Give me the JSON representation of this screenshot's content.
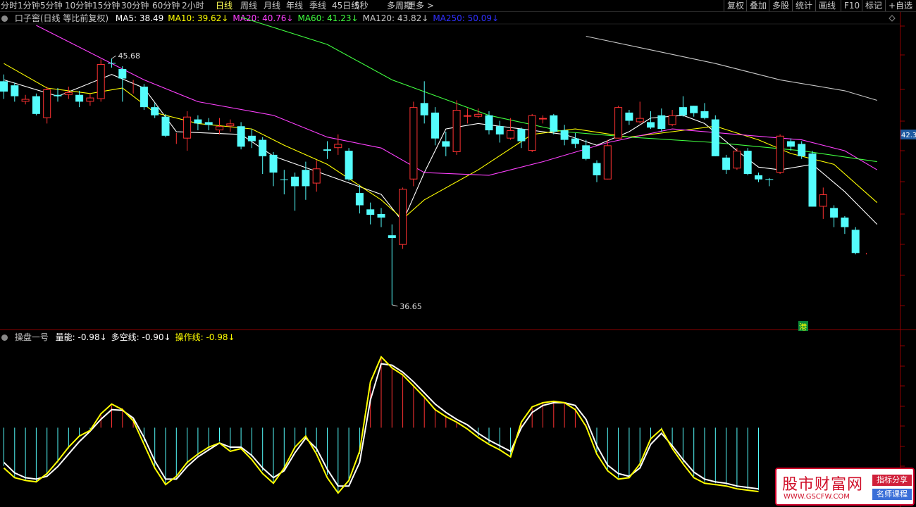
{
  "toolbar": {
    "tabs": [
      "分时",
      "1分钟",
      "5分钟",
      "10分钟",
      "15分钟",
      "30分钟",
      "60分钟",
      "2小时",
      "日线",
      "周线",
      "月线",
      "年线",
      "季线",
      "45日线",
      "5秒",
      "多周期",
      "更多 >"
    ],
    "active": "日线",
    "right_buttons": [
      "复权",
      "叠加",
      "多股",
      "统计",
      "画线",
      "F10",
      "标记",
      "+自选"
    ]
  },
  "main_legend": {
    "title": "口子窖(日线 等比前复权)",
    "items": [
      {
        "text": "MA5: 38.49",
        "color": "#ffffff"
      },
      {
        "text": "MA10: 39.62↓",
        "color": "#ffff00"
      },
      {
        "text": "MA20: 40.76↓",
        "color": "#ff40ff"
      },
      {
        "text": "MA60: 41.23↓",
        "color": "#40ff40"
      },
      {
        "text": "MA120: 43.82↓",
        "color": "#c8c8c8"
      },
      {
        "text": "MA250: 50.09↓",
        "color": "#3030ff"
      }
    ]
  },
  "sub_legend": {
    "title": "操盘一号",
    "items": [
      {
        "text": "量能: -0.98↓",
        "color": "#ffffff"
      },
      {
        "text": "多空线: -0.90↓",
        "color": "#ffffff"
      },
      {
        "text": "操作线: -0.98↓",
        "color": "#ffff00"
      }
    ]
  },
  "watermark": {
    "title": "股市财富网",
    "url": "WWW.GSCFW.COM",
    "tag1": "指标分享",
    "tag2": "名师课程"
  },
  "chart_data": [
    {
      "type": "candlestick",
      "ylim": [
        36.0,
        46.9
      ],
      "high_label": "45.68",
      "low_label": "36.65",
      "badge": "港",
      "price_tag": "42.3",
      "colors": {
        "up": "#ff3232",
        "down": "#54fcfc"
      },
      "candles": [
        [
          44.85,
          44.47,
          45.1,
          44.2
        ],
        [
          44.7,
          44.3,
          44.8,
          44.1
        ],
        [
          44.1,
          44.2,
          44.35,
          44.0
        ],
        [
          44.3,
          43.65,
          44.4,
          43.6
        ],
        [
          43.5,
          44.55,
          44.65,
          43.3
        ],
        [
          44.35,
          44.3,
          44.6,
          44.1
        ],
        [
          44.35,
          44.45,
          44.65,
          44.2
        ],
        [
          44.35,
          44.1,
          44.5,
          43.9
        ],
        [
          44.1,
          44.25,
          44.4,
          43.95
        ],
        [
          44.2,
          45.48,
          45.65,
          44.1
        ],
        [
          45.52,
          45.5,
          45.68,
          45.35
        ],
        [
          45.3,
          44.95,
          45.4,
          44.1
        ],
        [
          44.7,
          44.7,
          44.9,
          44.4
        ],
        [
          44.65,
          43.9,
          44.75,
          43.8
        ],
        [
          43.9,
          43.6,
          44.05,
          43.5
        ],
        [
          43.55,
          42.85,
          43.65,
          42.8
        ],
        [
          42.85,
          42.85,
          42.95,
          42.55
        ],
        [
          42.75,
          43.55,
          43.75,
          42.3
        ],
        [
          43.45,
          43.3,
          43.6,
          43.05
        ],
        [
          43.35,
          43.25,
          43.5,
          43.05
        ],
        [
          43.05,
          43.2,
          43.5,
          42.9
        ],
        [
          43.2,
          43.3,
          43.45,
          43.0
        ],
        [
          43.2,
          42.45,
          43.35,
          42.35
        ],
        [
          42.85,
          42.65,
          43.1,
          42.4
        ],
        [
          42.7,
          42.1,
          42.8,
          41.45
        ],
        [
          42.15,
          41.5,
          42.25,
          41.0
        ],
        [
          41.25,
          41.24,
          41.6,
          40.7
        ],
        [
          41.35,
          41.0,
          41.5,
          40.1
        ],
        [
          41.6,
          41.0,
          41.9,
          40.5
        ],
        [
          41.1,
          41.65,
          41.95,
          40.8
        ],
        [
          42.35,
          42.3,
          42.65,
          42.0
        ],
        [
          42.4,
          42.55,
          42.9,
          42.15
        ],
        [
          42.3,
          41.25,
          42.4,
          41.2
        ],
        [
          40.75,
          40.3,
          41.05,
          40.0
        ],
        [
          40.15,
          39.95,
          40.4,
          39.6
        ],
        [
          39.98,
          39.85,
          40.2,
          39.5
        ],
        [
          39.2,
          39.1,
          39.6,
          36.65
        ],
        [
          38.85,
          40.9,
          40.95,
          38.7
        ],
        [
          41.25,
          43.9,
          44.1,
          41.0
        ],
        [
          44.05,
          43.6,
          44.85,
          43.3
        ],
        [
          43.7,
          42.75,
          43.9,
          42.5
        ],
        [
          42.65,
          42.45,
          43.0,
          42.1
        ],
        [
          42.25,
          43.8,
          44.15,
          42.15
        ],
        [
          43.55,
          43.6,
          43.85,
          43.3
        ],
        [
          43.55,
          43.65,
          43.85,
          43.5
        ],
        [
          43.6,
          43.05,
          43.75,
          42.9
        ],
        [
          43.2,
          42.9,
          43.4,
          42.6
        ],
        [
          42.75,
          43.05,
          43.5,
          42.7
        ],
        [
          43.1,
          42.65,
          43.15,
          42.4
        ],
        [
          42.3,
          43.6,
          43.65,
          42.25
        ],
        [
          43.45,
          43.5,
          43.6,
          43.3
        ],
        [
          43.6,
          43.0,
          43.65,
          42.9
        ],
        [
          43.05,
          42.7,
          43.25,
          42.5
        ],
        [
          42.75,
          42.55,
          42.95,
          42.4
        ],
        [
          42.5,
          42.0,
          42.7,
          41.95
        ],
        [
          41.85,
          41.4,
          41.95,
          41.15
        ],
        [
          41.25,
          42.5,
          42.7,
          41.25
        ],
        [
          42.75,
          43.9,
          43.95,
          42.75
        ],
        [
          43.7,
          43.4,
          43.8,
          43.25
        ],
        [
          43.35,
          43.5,
          44.1,
          43.3
        ],
        [
          43.35,
          43.15,
          43.75,
          43.1
        ],
        [
          43.6,
          43.1,
          43.85,
          43.0
        ],
        [
          43.25,
          43.6,
          43.8,
          43.2
        ],
        [
          43.9,
          43.6,
          44.3,
          43.55
        ],
        [
          43.95,
          43.68,
          43.95,
          43.55
        ],
        [
          43.75,
          43.5,
          44.05,
          43.45
        ],
        [
          43.45,
          42.1,
          43.6,
          42.1
        ],
        [
          42.05,
          41.6,
          42.15,
          41.45
        ],
        [
          41.65,
          42.3,
          42.4,
          41.6
        ],
        [
          42.3,
          41.45,
          42.4,
          41.4
        ],
        [
          41.4,
          41.25,
          41.5,
          41.15
        ],
        [
          41.26,
          41.24,
          41.3,
          41.0
        ],
        [
          41.5,
          42.85,
          42.9,
          41.45
        ],
        [
          42.65,
          42.45,
          42.75,
          42.3
        ],
        [
          42.55,
          42.1,
          42.65,
          42.0
        ],
        [
          42.2,
          40.25,
          42.3,
          40.25
        ],
        [
          40.25,
          40.7,
          40.95,
          39.8
        ],
        [
          40.2,
          39.85,
          40.3,
          39.5
        ],
        [
          39.85,
          39.5,
          39.9,
          39.25
        ],
        [
          39.4,
          38.55,
          39.5,
          38.5
        ],
        [
          38.5,
          38.5,
          38.55,
          38.5
        ]
      ],
      "ma": [
        {
          "name": "MA5",
          "color": "#ffffff",
          "points": [
            [
              0,
              44.9
            ],
            [
              5,
              44.3
            ],
            [
              10,
              45.1
            ],
            [
              13,
              44.6
            ],
            [
              16,
              43.0
            ],
            [
              22,
              42.9
            ],
            [
              25,
              42.1
            ],
            [
              30,
              41.4
            ],
            [
              35,
              40.7
            ],
            [
              37,
              39.7
            ],
            [
              39,
              41.5
            ],
            [
              41,
              43.1
            ],
            [
              44,
              43.3
            ],
            [
              48,
              43.1
            ],
            [
              52,
              42.9
            ],
            [
              55,
              42.5
            ],
            [
              58,
              43.0
            ],
            [
              60,
              43.5
            ],
            [
              63,
              43.6
            ],
            [
              65,
              43.3
            ],
            [
              68,
              42.3
            ],
            [
              70,
              41.7
            ],
            [
              72,
              41.6
            ],
            [
              75,
              41.8
            ],
            [
              78,
              40.8
            ],
            [
              81,
              39.6
            ]
          ]
        },
        {
          "name": "MA10",
          "color": "#ffff00",
          "points": [
            [
              0,
              45.5
            ],
            [
              4,
              44.6
            ],
            [
              8,
              44.4
            ],
            [
              11,
              44.6
            ],
            [
              14,
              43.7
            ],
            [
              18,
              43.3
            ],
            [
              23,
              43.1
            ],
            [
              26,
              42.5
            ],
            [
              30,
              41.8
            ],
            [
              35,
              40.5
            ],
            [
              37,
              39.8
            ],
            [
              39,
              40.5
            ],
            [
              44,
              41.6
            ],
            [
              49,
              42.9
            ],
            [
              53,
              43.1
            ],
            [
              58,
              42.8
            ],
            [
              62,
              43.0
            ],
            [
              66,
              43.2
            ],
            [
              70,
              42.7
            ],
            [
              73,
              42.2
            ],
            [
              77,
              41.8
            ],
            [
              81,
              40.4
            ]
          ]
        },
        {
          "name": "MA20",
          "color": "#ff40ff",
          "points": [
            [
              3,
              46.9
            ],
            [
              9,
              45.7
            ],
            [
              13,
              44.9
            ],
            [
              18,
              44.1
            ],
            [
              25,
              43.6
            ],
            [
              30,
              42.8
            ],
            [
              35,
              42.4
            ],
            [
              39,
              41.5
            ],
            [
              45,
              41.4
            ],
            [
              50,
              41.9
            ],
            [
              56,
              42.6
            ],
            [
              62,
              43.1
            ],
            [
              68,
              42.9
            ],
            [
              74,
              42.7
            ],
            [
              78,
              42.3
            ],
            [
              81,
              41.6
            ]
          ]
        },
        {
          "name": "MA60",
          "color": "#40ff40",
          "points": [
            [
              22,
              47.2
            ],
            [
              30,
              46.2
            ],
            [
              36,
              44.9
            ],
            [
              45,
              43.6
            ],
            [
              52,
              43.0
            ],
            [
              58,
              42.8
            ],
            [
              66,
              42.6
            ],
            [
              74,
              42.3
            ],
            [
              81,
              41.9
            ]
          ]
        },
        {
          "name": "MA120",
          "color": "#c8c8c8",
          "points": [
            [
              54,
              46.5
            ],
            [
              60,
              46.0
            ],
            [
              66,
              45.5
            ],
            [
              72,
              44.9
            ],
            [
              78,
              44.5
            ],
            [
              81,
              44.15
            ]
          ]
        }
      ]
    },
    {
      "type": "line",
      "ylim": [
        -1.0,
        1.2
      ],
      "zero": 0.0,
      "bars": [
        -0.55,
        -0.72,
        -0.75,
        -0.78,
        -0.68,
        -0.5,
        -0.3,
        -0.12,
        -0.06,
        0.18,
        0.32,
        0.28,
        0.12,
        -0.2,
        -0.55,
        -0.8,
        -0.72,
        -0.52,
        -0.4,
        -0.3,
        -0.2,
        -0.32,
        -0.28,
        -0.42,
        -0.62,
        -0.78,
        -0.6,
        -0.3,
        -0.12,
        -0.35,
        -0.68,
        -0.92,
        -0.78,
        -0.38,
        0.6,
        1.0,
        0.88,
        0.78,
        0.62,
        0.45,
        0.28,
        0.18,
        0.08,
        0.0,
        -0.12,
        -0.22,
        -0.3,
        -0.4,
        0.06,
        0.28,
        0.35,
        0.37,
        0.36,
        0.28,
        0.05,
        -0.35,
        -0.6,
        -0.72,
        -0.72,
        -0.55,
        -0.18,
        -0.02,
        -0.28,
        -0.5,
        -0.7,
        -0.78,
        -0.8,
        -0.82,
        -0.86,
        -0.88,
        -0.9
      ],
      "series": [
        {
          "name": "多空线",
          "color": "#ffffff",
          "values": [
            -0.5,
            -0.65,
            -0.72,
            -0.74,
            -0.7,
            -0.56,
            -0.38,
            -0.2,
            -0.05,
            0.12,
            0.26,
            0.25,
            0.14,
            -0.14,
            -0.48,
            -0.74,
            -0.74,
            -0.56,
            -0.42,
            -0.32,
            -0.22,
            -0.28,
            -0.28,
            -0.4,
            -0.58,
            -0.72,
            -0.62,
            -0.36,
            -0.15,
            -0.3,
            -0.6,
            -0.84,
            -0.84,
            -0.5,
            0.4,
            0.92,
            0.9,
            0.8,
            0.66,
            0.5,
            0.34,
            0.22,
            0.12,
            0.04,
            -0.08,
            -0.18,
            -0.26,
            -0.34,
            0.0,
            0.22,
            0.32,
            0.36,
            0.36,
            0.32,
            0.12,
            -0.26,
            -0.54,
            -0.66,
            -0.7,
            -0.58,
            -0.24,
            -0.08,
            -0.26,
            -0.46,
            -0.64,
            -0.74,
            -0.78,
            -0.8,
            -0.84,
            -0.86,
            -0.88
          ]
        },
        {
          "name": "操作线",
          "color": "#ffff00",
          "values": [
            -0.58,
            -0.72,
            -0.76,
            -0.78,
            -0.66,
            -0.48,
            -0.28,
            -0.12,
            -0.04,
            0.2,
            0.34,
            0.26,
            0.1,
            -0.24,
            -0.58,
            -0.82,
            -0.7,
            -0.5,
            -0.38,
            -0.28,
            -0.22,
            -0.34,
            -0.3,
            -0.46,
            -0.66,
            -0.8,
            -0.58,
            -0.28,
            -0.12,
            -0.38,
            -0.72,
            -0.94,
            -0.76,
            -0.34,
            0.66,
            1.02,
            0.86,
            0.76,
            0.6,
            0.44,
            0.26,
            0.16,
            0.08,
            -0.02,
            -0.14,
            -0.24,
            -0.32,
            -0.42,
            0.08,
            0.3,
            0.36,
            0.38,
            0.36,
            0.26,
            0.02,
            -0.38,
            -0.62,
            -0.74,
            -0.72,
            -0.52,
            -0.16,
            -0.02,
            -0.3,
            -0.52,
            -0.72,
            -0.8,
            -0.82,
            -0.84,
            -0.88,
            -0.9,
            -0.92
          ]
        }
      ]
    }
  ]
}
